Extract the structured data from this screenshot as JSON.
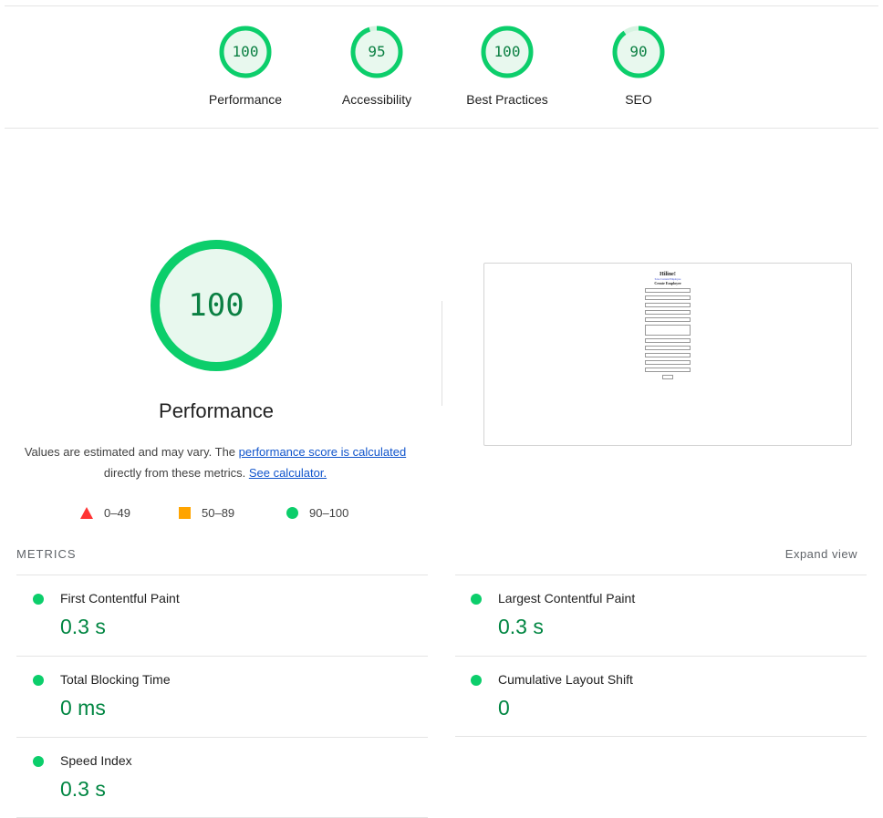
{
  "scores": [
    {
      "value": "100",
      "label": "Performance",
      "fraction": 1.0
    },
    {
      "value": "95",
      "label": "Accessibility",
      "fraction": 0.95
    },
    {
      "value": "100",
      "label": "Best Practices",
      "fraction": 1.0
    },
    {
      "value": "90",
      "label": "SEO",
      "fraction": 0.9
    }
  ],
  "main_gauge": {
    "value": "100",
    "title": "Performance",
    "fraction": 1.0
  },
  "description": {
    "text1": "Values are estimated and may vary. The ",
    "link1": "performance score is calculated",
    "text2": " directly from these metrics. ",
    "link2": "See calculator."
  },
  "legend": [
    {
      "range": "0–49",
      "shape": "triangle",
      "color": "#ff3333"
    },
    {
      "range": "50–89",
      "shape": "square",
      "color": "#ffa400"
    },
    {
      "range": "90–100",
      "shape": "circle",
      "color": "#0cce6b"
    }
  ],
  "metrics_header": {
    "label": "METRICS",
    "expand": "Expand view"
  },
  "metrics": [
    {
      "name": "First Contentful Paint",
      "value": "0.3 s"
    },
    {
      "name": "Largest Contentful Paint",
      "value": "0.3 s"
    },
    {
      "name": "Total Blocking Time",
      "value": "0 ms"
    },
    {
      "name": "Cumulative Layout Shift",
      "value": "0"
    },
    {
      "name": "Speed Index",
      "value": "0.3 s"
    }
  ],
  "thumbnail": {
    "heading": "Hiline!",
    "link": "Save Current Employee",
    "subheading": "Create Employee"
  },
  "colors": {
    "pass": "#0cce6b",
    "pass_text": "#018642",
    "pass_bg": "#e8f8ee"
  }
}
